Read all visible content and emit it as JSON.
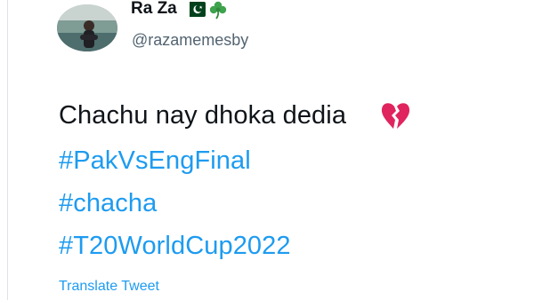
{
  "tweet": {
    "author": {
      "display_name": "Ra Za",
      "name_emojis": [
        "pakistan-flag-icon",
        "shamrock-icon"
      ],
      "handle": "@razamemesby"
    },
    "text": "Chachu nay dhoka dedia",
    "text_emoji": "broken-heart-icon",
    "hashtags": [
      "#PakVsEngFinal",
      "#chacha",
      "#T20WorldCup2022"
    ],
    "translate_label": "Translate Tweet"
  },
  "colors": {
    "link_blue": "#1d9bf0",
    "secondary_text": "#536471",
    "primary_text": "#0f1419",
    "broken_heart_red": "#e0245e",
    "pakistan_green": "#01411c"
  }
}
